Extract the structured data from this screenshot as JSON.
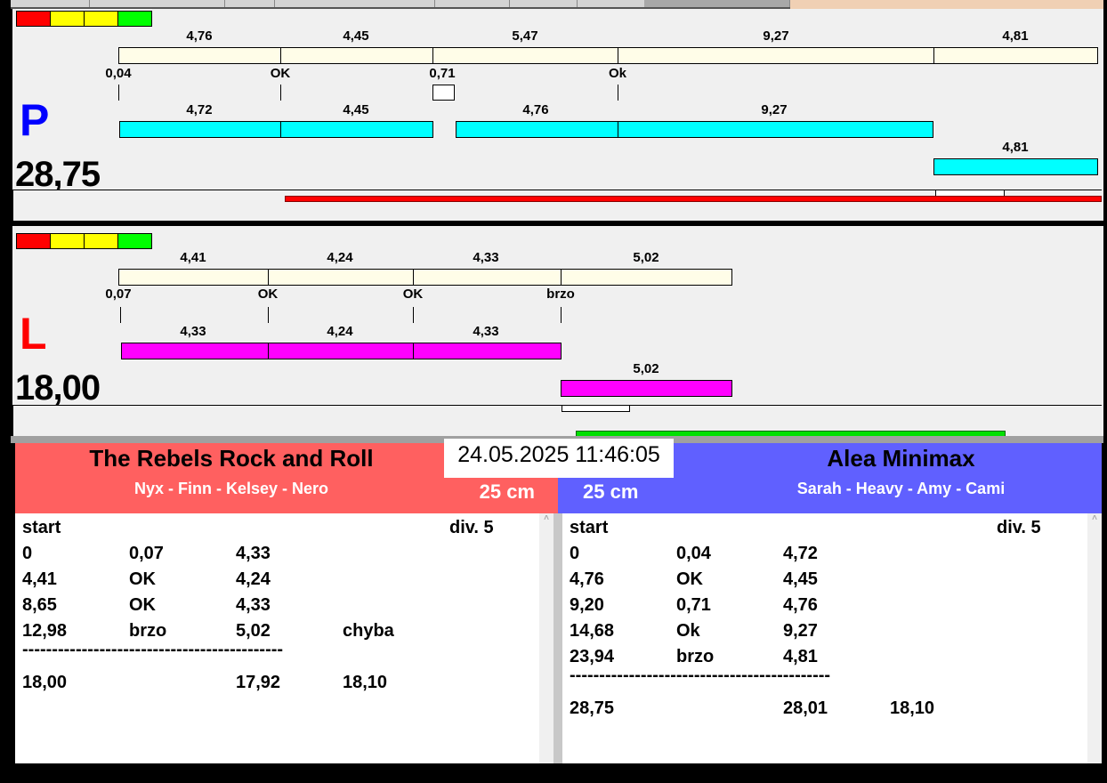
{
  "legend_colors": [
    "#ff0000",
    "#ffff00",
    "#ffff00",
    "#00ff00"
  ],
  "lane_p": {
    "letter": "P",
    "total": "28,75",
    "reference": {
      "labels": [
        "4,76",
        "4,45",
        "5,47",
        "9,27",
        "4,81"
      ],
      "marks": [
        "0,04",
        "OK",
        "0,71",
        "Ok"
      ]
    },
    "actual": {
      "labels": [
        "4,72",
        "4,45",
        "4,76",
        "9,27",
        "4,81"
      ]
    }
  },
  "lane_l": {
    "letter": "L",
    "total": "18,00",
    "reference": {
      "labels": [
        "4,41",
        "4,24",
        "4,33",
        "5,02"
      ],
      "marks": [
        "0,07",
        "OK",
        "OK",
        "brzo"
      ]
    },
    "actual": {
      "labels": [
        "4,33",
        "4,24",
        "4,33",
        "5,02"
      ]
    }
  },
  "datetime": "24.05.2025 11:46:05",
  "team_left": {
    "name": "The Rebels Rock and Roll",
    "members": "Nyx - Finn - Kelsey - Nero",
    "distance": "25 cm",
    "color": "#ff6060",
    "header": [
      "start",
      "div.  5"
    ],
    "rows": [
      [
        "0",
        "0,07",
        "4,33",
        ""
      ],
      [
        "4,41",
        "OK",
        "4,24",
        ""
      ],
      [
        "8,65",
        "OK",
        "4,33",
        ""
      ],
      [
        "12,98",
        "brzo",
        "5,02",
        "chyba"
      ]
    ],
    "separator": "--------------------------------------------",
    "totals": [
      "18,00",
      "",
      "17,92",
      "18,10"
    ]
  },
  "team_right": {
    "name": "Alea Minimax",
    "members": "Sarah - Heavy - Amy - Cami",
    "distance": "25 cm",
    "color": "#6060ff",
    "header": [
      "start",
      "div.  5"
    ],
    "rows": [
      [
        "0",
        "0,04",
        "4,72",
        ""
      ],
      [
        "4,76",
        "OK",
        "4,45",
        ""
      ],
      [
        "9,20",
        "0,71",
        "4,76",
        ""
      ],
      [
        "14,68",
        "Ok",
        "9,27",
        ""
      ],
      [
        "23,94",
        "brzo",
        "4,81",
        ""
      ]
    ],
    "separator": "--------------------------------------------",
    "totals": [
      "28,75",
      "",
      "28,01",
      "18,10"
    ]
  }
}
